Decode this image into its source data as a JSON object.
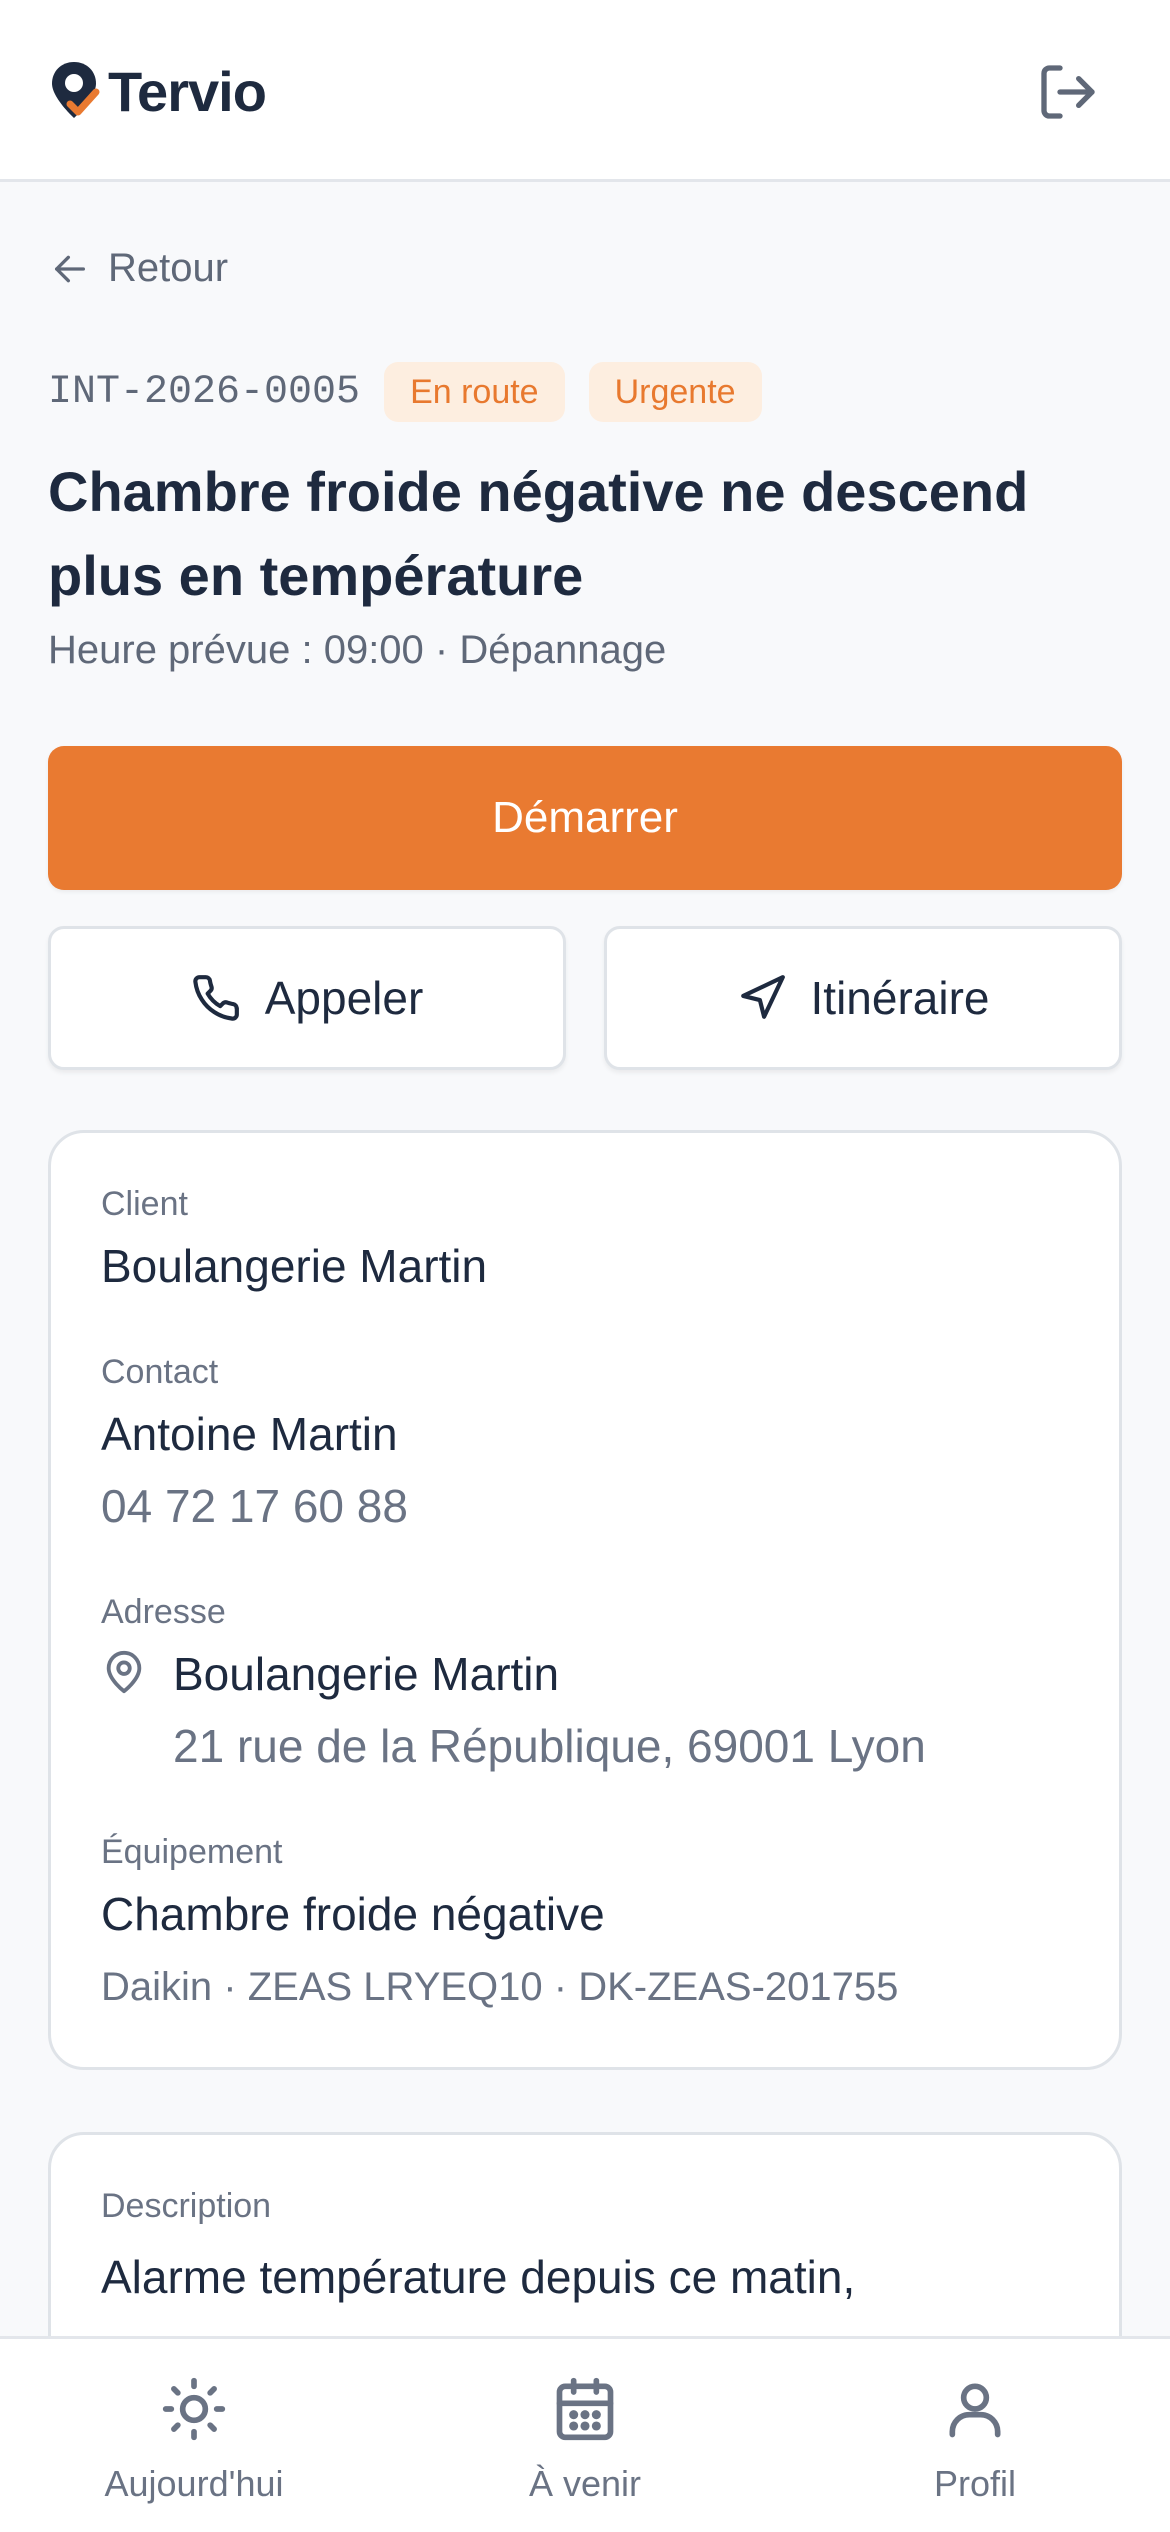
{
  "header": {
    "app_name": "Tervio",
    "brand_color": "#e97a31",
    "logo_icon": "map-pin-check-icon",
    "logout_icon": "logout-icon"
  },
  "back": {
    "label": "Retour",
    "icon": "arrow-left-icon"
  },
  "intervention": {
    "reference": "INT-2026-0005",
    "status_badge": "En route",
    "priority_badge": "Urgente",
    "title": "Chambre froide négative ne descend plus en température",
    "subtitle": "Heure prévue : 09:00 · Dépannage"
  },
  "actions": {
    "start_label": "Démarrer",
    "call_label": "Appeler",
    "call_icon": "phone-icon",
    "route_label": "Itinéraire",
    "route_icon": "navigation-icon"
  },
  "details": {
    "client_label": "Client",
    "client_value": "Boulangerie Martin",
    "contact_label": "Contact",
    "contact_name": "Antoine Martin",
    "contact_phone": "04 72 17 60 88",
    "address_label": "Adresse",
    "address_icon": "map-pin-icon",
    "address_name": "Boulangerie Martin",
    "address_line": "21 rue de la République, 69001 Lyon",
    "equipment_label": "Équipement",
    "equipment_value": "Chambre froide négative",
    "equipment_meta": "Daikin · ZEAS LRYEQ10 · DK-ZEAS-201755"
  },
  "description": {
    "label": "Description",
    "text": "Alarme température depuis ce matin,"
  },
  "nav": {
    "items": [
      {
        "label": "Aujourd'hui",
        "icon": "sun-icon"
      },
      {
        "label": "À venir",
        "icon": "calendar-icon"
      },
      {
        "label": "Profil",
        "icon": "user-icon"
      }
    ]
  }
}
